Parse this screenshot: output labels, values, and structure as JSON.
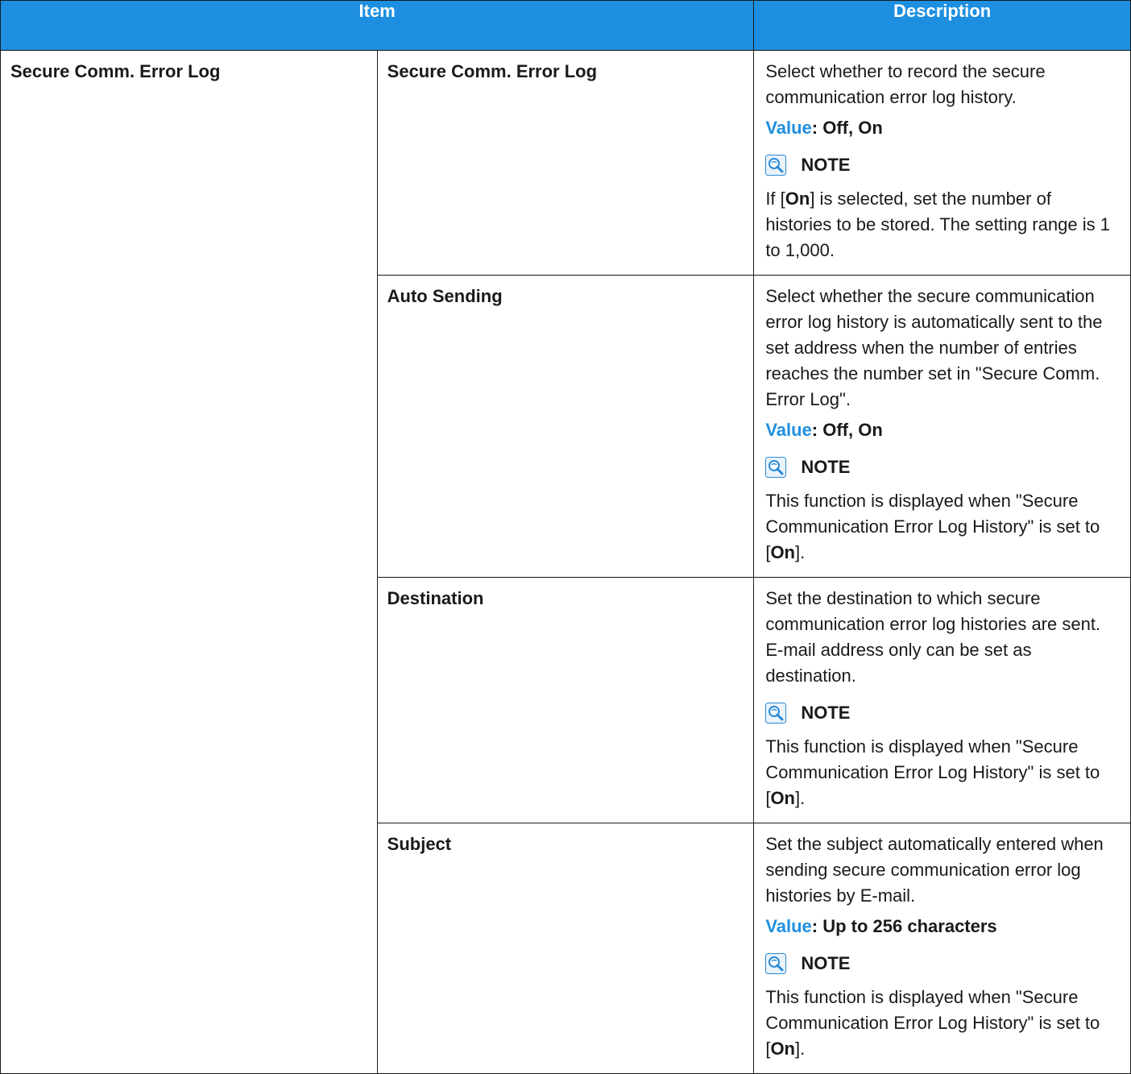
{
  "header": {
    "item": "Item",
    "description": "Description"
  },
  "group": {
    "label": "Secure Comm. Error Log"
  },
  "note_label": "NOTE",
  "value_label": "Value",
  "rows": [
    {
      "name": "Secure Comm. Error Log",
      "desc": "Select whether to record the secure communication error log history.",
      "value": ": Off, On",
      "note_pre": "If [",
      "note_bold": "On",
      "note_post": "] is selected, set the number of histories to be stored. The setting range is 1 to 1,000."
    },
    {
      "name": "Auto Sending",
      "desc": "Select whether the secure communication error log history is automatically sent to the set address when the number of entries reaches the number set in \"Secure Comm. Error Log\".",
      "value": ": Off, On",
      "note_pre": "This function is displayed when \"Secure Communication Error Log History\" is set to [",
      "note_bold": "On",
      "note_post": "]."
    },
    {
      "name": "Destination",
      "desc": "Set the destination to which secure communication error log histories are sent. E-mail address only can be set as destination.",
      "note_pre": "This function is displayed when \"Secure Communication Error Log History\" is set to [",
      "note_bold": "On",
      "note_post": "]."
    },
    {
      "name": "Subject",
      "desc": "Set the subject automatically entered when sending secure communication error log histories by E-mail.",
      "value": ": Up to 256 characters",
      "note_pre": "This function is displayed when \"Secure Communication Error Log History\" is set to [",
      "note_bold": "On",
      "note_post": "]."
    }
  ],
  "colors": {
    "header_bg": "#1e8fe0",
    "value_label": "#1e8fe0",
    "icon": "#2a8ad6"
  },
  "icons": {
    "note": "lightbulb-hint-icon"
  }
}
